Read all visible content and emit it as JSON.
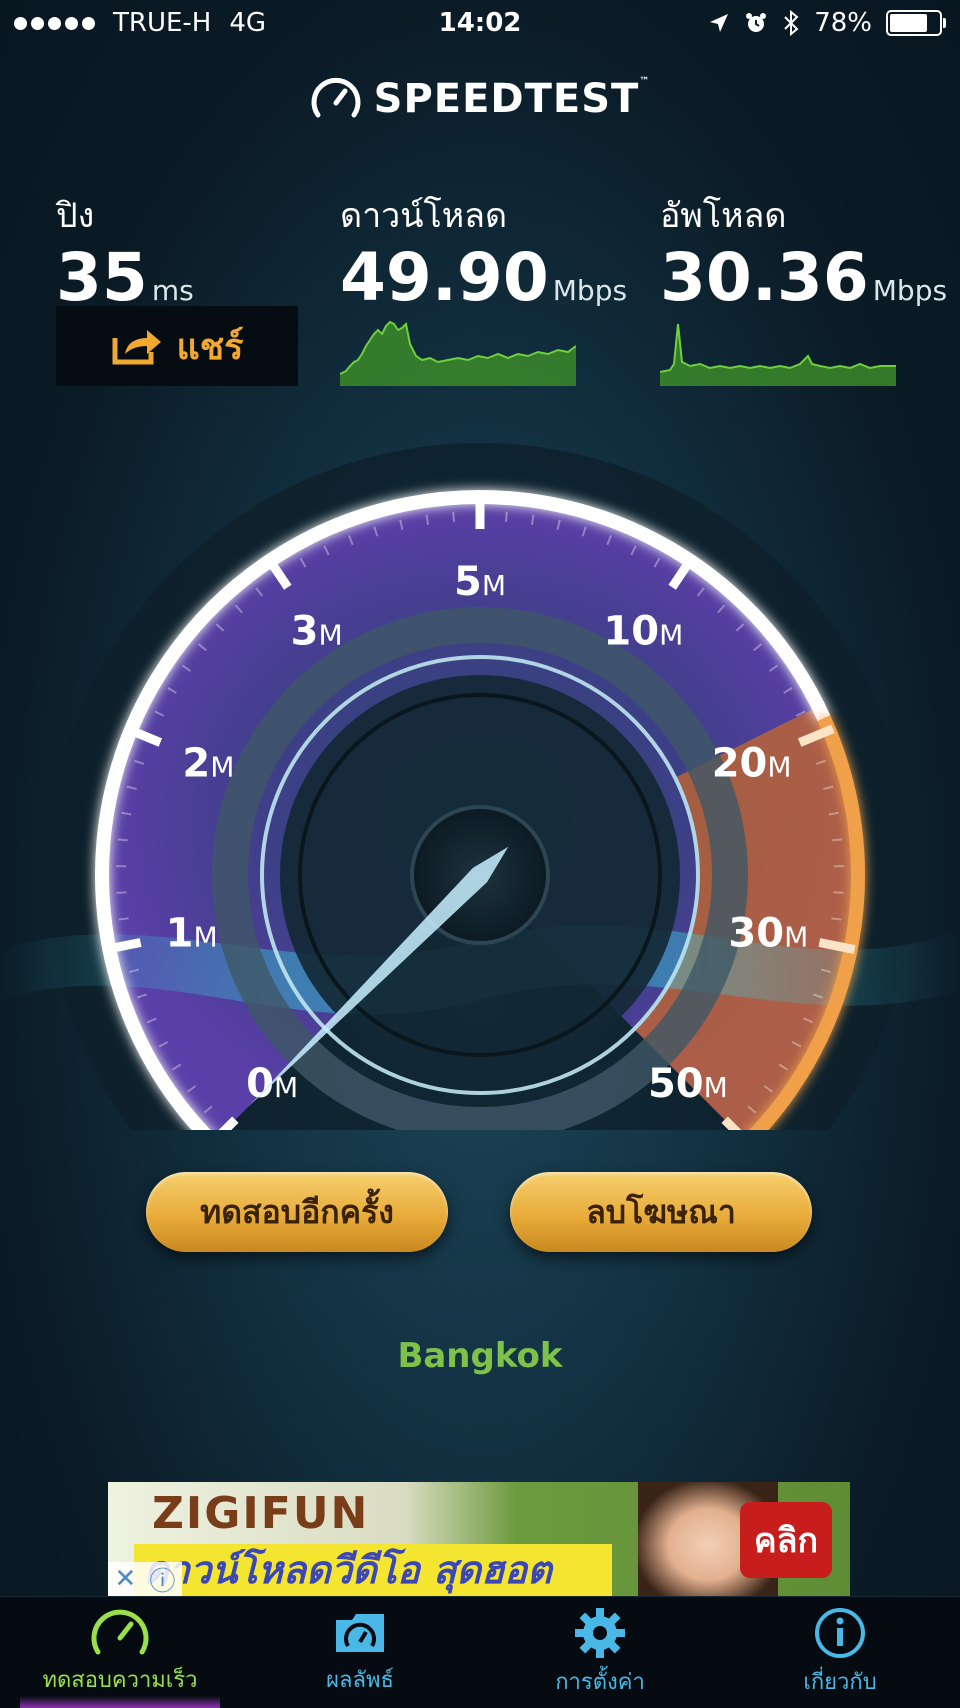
{
  "status_bar": {
    "carrier": "TRUE-H",
    "network": "4G",
    "time": "14:02",
    "battery_percent": "78%",
    "battery_level": 0.78,
    "signal_bars": 5
  },
  "header": {
    "logo_text": "SPEEDTEST",
    "trademark": "™"
  },
  "metrics": {
    "ping": {
      "label": "ปิง",
      "value": "35",
      "unit": "ms"
    },
    "download": {
      "label": "ดาวน์โหลด",
      "value": "49.90",
      "unit": "Mbps"
    },
    "upload": {
      "label": "อัพโหลด",
      "value": "30.36",
      "unit": "Mbps"
    }
  },
  "share_button": {
    "label": "แชร์"
  },
  "gauge": {
    "ticks": [
      {
        "num": "0",
        "unit": "M"
      },
      {
        "num": "1",
        "unit": "M"
      },
      {
        "num": "2",
        "unit": "M"
      },
      {
        "num": "3",
        "unit": "M"
      },
      {
        "num": "5",
        "unit": "M"
      },
      {
        "num": "10",
        "unit": "M"
      },
      {
        "num": "20",
        "unit": "M"
      },
      {
        "num": "30",
        "unit": "M"
      },
      {
        "num": "50",
        "unit": "M"
      }
    ],
    "needle_value": 0
  },
  "buttons": {
    "test_again": "ทดสอบอีกครั้ง",
    "remove_ads": "ลบโฆษณา"
  },
  "server": {
    "location": "Bangkok"
  },
  "ad": {
    "brand": "ZIGIFUN",
    "tagline": "ดาวน์โหลดวีดีโอ สุดฮอต",
    "cta": "คลิก"
  },
  "tabbar": {
    "tabs": [
      {
        "label": "ทดสอบความเร็ว",
        "icon": "speedometer-icon",
        "active": true
      },
      {
        "label": "ผลลัพธ์",
        "icon": "results-folder-icon",
        "active": false
      },
      {
        "label": "การตั้งค่า",
        "icon": "gear-icon",
        "active": false
      },
      {
        "label": "เกี่ยวกับ",
        "icon": "info-icon",
        "active": false
      }
    ]
  },
  "colors": {
    "accent_orange": "#f0a830",
    "server_green": "#7fc24a",
    "tab_blue": "#49b8e6",
    "tab_active_green": "#9be04a"
  }
}
